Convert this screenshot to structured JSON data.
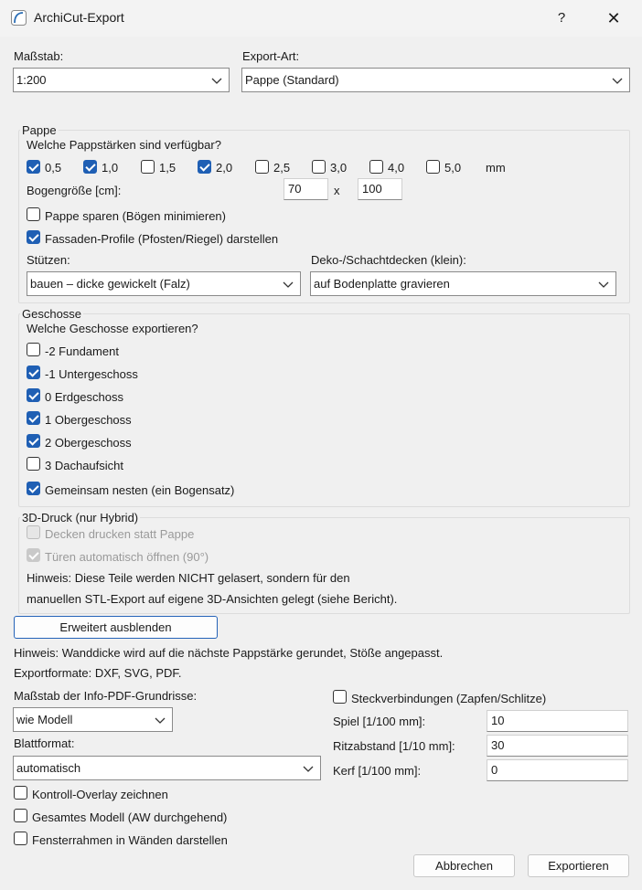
{
  "window": {
    "title": "ArchiCut-Export",
    "help": "?",
    "close": "✕"
  },
  "massstab": {
    "label": "Maßstab:",
    "value": "1:200"
  },
  "export_art": {
    "label": "Export-Art:",
    "value": "Pappe (Standard)"
  },
  "pappe": {
    "title": "Pappe",
    "question": "Welche Pappstärken sind verfügbar?",
    "thicknesses": [
      {
        "label": "0,5",
        "checked": true
      },
      {
        "label": "1,0",
        "checked": true
      },
      {
        "label": "1,5",
        "checked": false
      },
      {
        "label": "2,0",
        "checked": true
      },
      {
        "label": "2,5",
        "checked": false
      },
      {
        "label": "3,0",
        "checked": false
      },
      {
        "label": "4,0",
        "checked": false
      },
      {
        "label": "5,0",
        "checked": false
      }
    ],
    "unit": "mm",
    "bogen_label": "Bogengröße [cm]:",
    "bogen_w": "70",
    "bogen_x": "x",
    "bogen_h": "100",
    "sparen": {
      "label": "Pappe sparen (Bögen minimieren)",
      "checked": false
    },
    "fassaden": {
      "label": "Fassaden-Profile (Pfosten/Riegel) darstellen",
      "checked": true
    },
    "stuetzen_label": "Stützen:",
    "stuetzen_value": "bauen – dicke gewickelt (Falz)",
    "deko_label": "Deko-/Schachtdecken (klein):",
    "deko_value": "auf Bodenplatte gravieren"
  },
  "geschosse": {
    "title": "Geschosse",
    "question": "Welche Geschosse exportieren?",
    "items": [
      {
        "label": "-2 Fundament",
        "checked": false
      },
      {
        "label": "-1 Untergeschoss",
        "checked": true
      },
      {
        "label": "0 Erdgeschoss",
        "checked": true
      },
      {
        "label": "1 Obergeschoss",
        "checked": true
      },
      {
        "label": "2 Obergeschoss",
        "checked": true
      },
      {
        "label": "3 Dachaufsicht",
        "checked": false
      },
      {
        "label": "Gemeinsam nesten (ein Bogensatz)",
        "checked": true
      }
    ]
  },
  "druck": {
    "title": "3D-Druck (nur Hybrid)",
    "decken": {
      "label": "Decken drucken statt Pappe",
      "checked": false
    },
    "tueren": {
      "label": "Türen automatisch öffnen (90°)",
      "checked": true
    },
    "hint1": "Hinweis: Diese Teile werden NICHT gelasert, sondern für den",
    "hint2": "manuellen STL-Export auf eigene 3D-Ansichten gelegt (siehe Bericht)."
  },
  "erweitert_button": "Erweitert ausblenden",
  "hint_wand": "Hinweis: Wanddicke wird auf die nächste Pappstärke gerundet, Stöße angepasst.",
  "hint_formate": "Exportformate: DXF, SVG, PDF.",
  "info_pdf": {
    "label": "Maßstab der Info-PDF-Grundrisse:",
    "value": "wie Modell"
  },
  "blatt": {
    "label": "Blattformat:",
    "value": "automatisch"
  },
  "steck": {
    "label": "Steckverbindungen (Zapfen/Schlitze)",
    "checked": false
  },
  "spiel": {
    "label": "Spiel [1/100 mm]:",
    "value": "10"
  },
  "ritz": {
    "label": "Ritzabstand [1/10 mm]:",
    "value": "30"
  },
  "kerf": {
    "label": "Kerf [1/100 mm]:",
    "value": "0"
  },
  "kontroll": {
    "label": "Kontroll-Overlay zeichnen",
    "checked": false
  },
  "gesamt": {
    "label": "Gesamtes Modell (AW durchgehend)",
    "checked": false
  },
  "fenster": {
    "label": "Fensterrahmen in Wänden darstellen",
    "checked": false
  },
  "abbrechen": "Abbrechen",
  "exportieren": "Exportieren",
  "colors": {
    "accent": "#1f5fb4",
    "focus_border": "#2563b8",
    "window_bg": "#f0f0f0"
  }
}
